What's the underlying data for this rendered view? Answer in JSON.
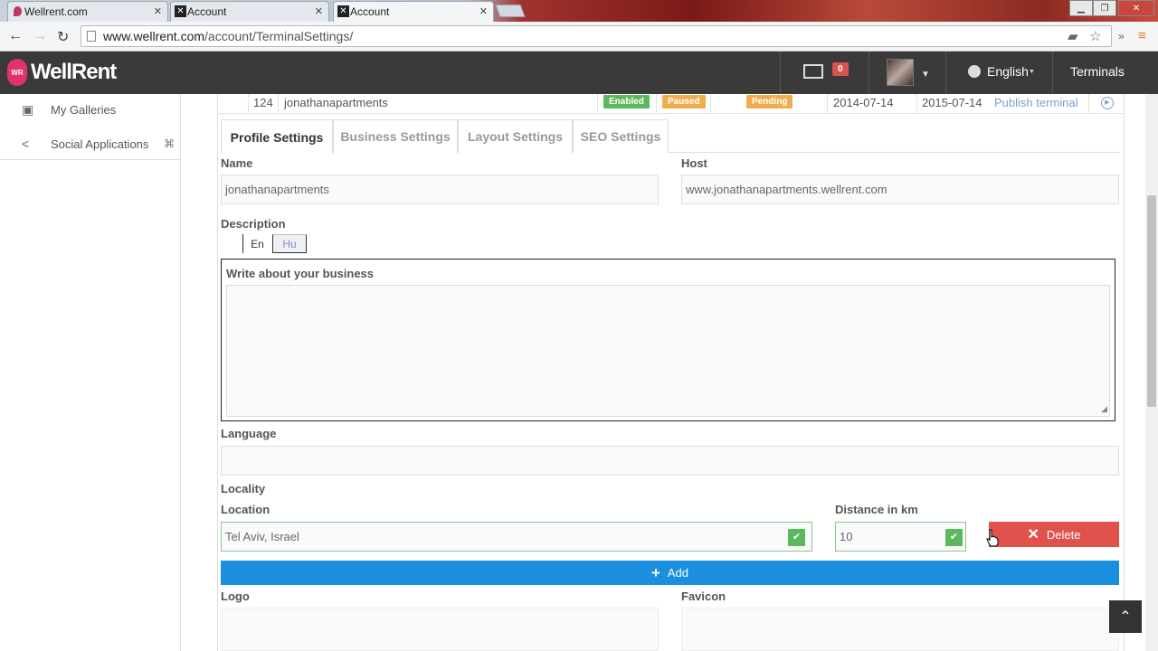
{
  "browser": {
    "tabs": [
      {
        "title": "Wellrent.com",
        "favicon": "map-pin-icon"
      },
      {
        "title": "Account",
        "favicon": "x-logo-icon"
      },
      {
        "title": "Account",
        "favicon": "x-logo-icon"
      }
    ],
    "url_host": "www.wellrent.com",
    "url_path": "/account/TerminalSettings/"
  },
  "header": {
    "brand": "WellRent",
    "brand_pin": "WR",
    "messages_count": "0",
    "language": "English",
    "terminals_label": "Terminals"
  },
  "sidebar": {
    "items": [
      {
        "label": "My Galleries",
        "icon": "image-icon"
      },
      {
        "label": "Social Applications",
        "icon": "share-icon"
      }
    ]
  },
  "terminal_row": {
    "id": "124",
    "name": "jonathanapartments",
    "status_enabled": "Enabled",
    "status_paused": "Paused",
    "status_pending": "Pending",
    "start_date": "2014-07-14",
    "end_date": "2015-07-14",
    "action": "Publish terminal"
  },
  "tabs": [
    "Profile Settings",
    "Business Settings",
    "Layout Settings",
    "SEO Settings"
  ],
  "form": {
    "name_label": "Name",
    "name_value": "jonathanapartments",
    "host_label": "Host",
    "host_value": "www.jonathanapartments.wellrent.com",
    "description_label": "Description",
    "lang_en": "En",
    "lang_hu": "Hu",
    "description_placeholder": "Write about your business",
    "language_label": "Language",
    "locality_label": "Locality",
    "location_label": "Location",
    "location_value": "Tel Aviv, Israel",
    "distance_label": "Distance in km",
    "distance_value": "10",
    "delete_label": "Delete",
    "add_label": "Add",
    "logo_label": "Logo",
    "favicon_label": "Favicon"
  },
  "colors": {
    "enabled": "#5cb85c",
    "paused": "#f0ad4e",
    "pending": "#f0ad4e",
    "delete": "#e0524b",
    "add": "#1a8fe0",
    "header_bg": "#3a3a3a",
    "brand_pink": "#e0336c"
  }
}
